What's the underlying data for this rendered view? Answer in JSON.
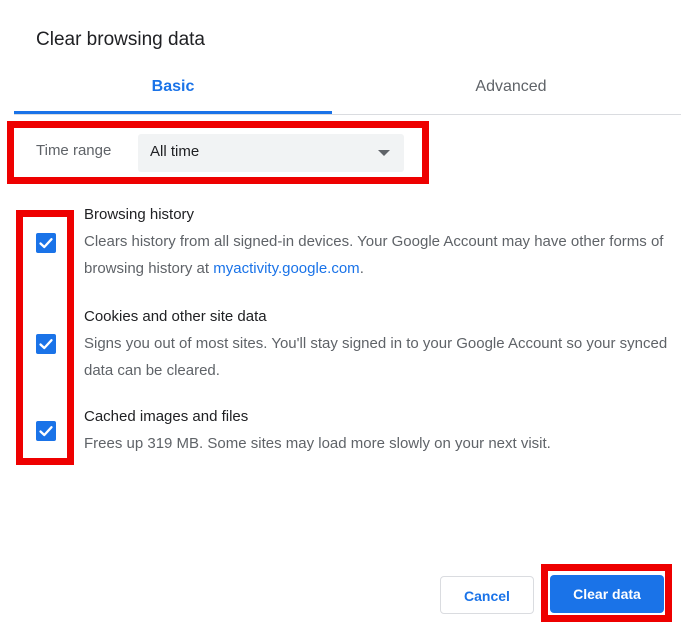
{
  "dialog": {
    "title": "Clear browsing data"
  },
  "tabs": [
    {
      "label": "Basic",
      "active": true
    },
    {
      "label": "Advanced",
      "active": false
    }
  ],
  "time_range": {
    "label": "Time range",
    "value": "All time"
  },
  "options": [
    {
      "title": "Browsing history",
      "desc_before_link": "Clears history from all signed-in devices. Your Google Account may have other forms of browsing history at ",
      "link": "myactivity.google.com",
      "desc_after_link": ".",
      "checked": true
    },
    {
      "title": "Cookies and other site data",
      "desc": "Signs you out of most sites. You'll stay signed in to your Google Account so your synced data can be cleared.",
      "checked": true
    },
    {
      "title": "Cached images and files",
      "desc": "Frees up 319 MB. Some sites may load more slowly on your next visit.",
      "checked": true
    }
  ],
  "buttons": {
    "cancel": "Cancel",
    "clear": "Clear data"
  },
  "colors": {
    "accent": "#1a73e8",
    "highlight": "#ee0000",
    "muted_text": "#5f6368"
  },
  "icons": {
    "dropdown": "caret-down-icon",
    "checkbox": "checkmark-icon"
  }
}
